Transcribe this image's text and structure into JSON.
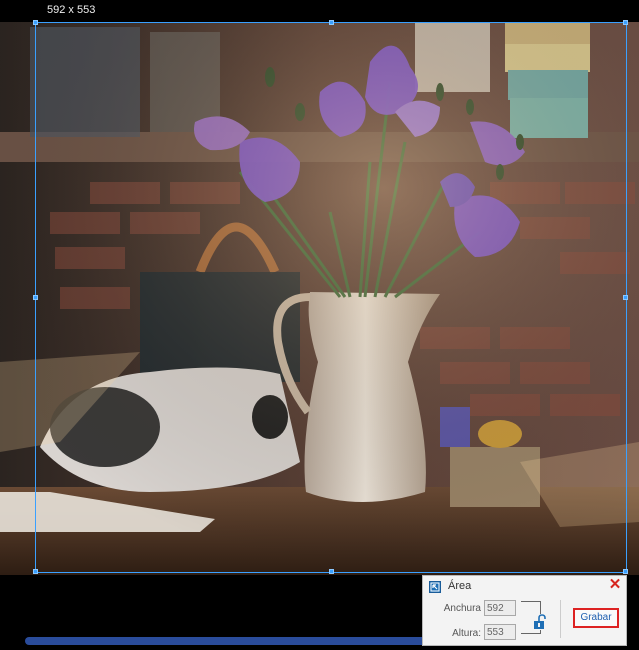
{
  "selection": {
    "dimensions_label": "592 x 553"
  },
  "video": {
    "description_icon": "video-frame-image"
  },
  "area_panel": {
    "title": "Área",
    "width_label": "Anchura",
    "width_value": "592",
    "height_label": "Altura:",
    "height_value": "553",
    "record_label": "Grabar",
    "close_icon": "close-icon",
    "lock_icon": "unlocked-padlock-icon"
  },
  "colors": {
    "selection_border": "#3aa0ff",
    "close": "#d6261f",
    "record_border": "#dd2222",
    "record_text": "#1f5fb0",
    "progress": "#2a4c9b"
  }
}
